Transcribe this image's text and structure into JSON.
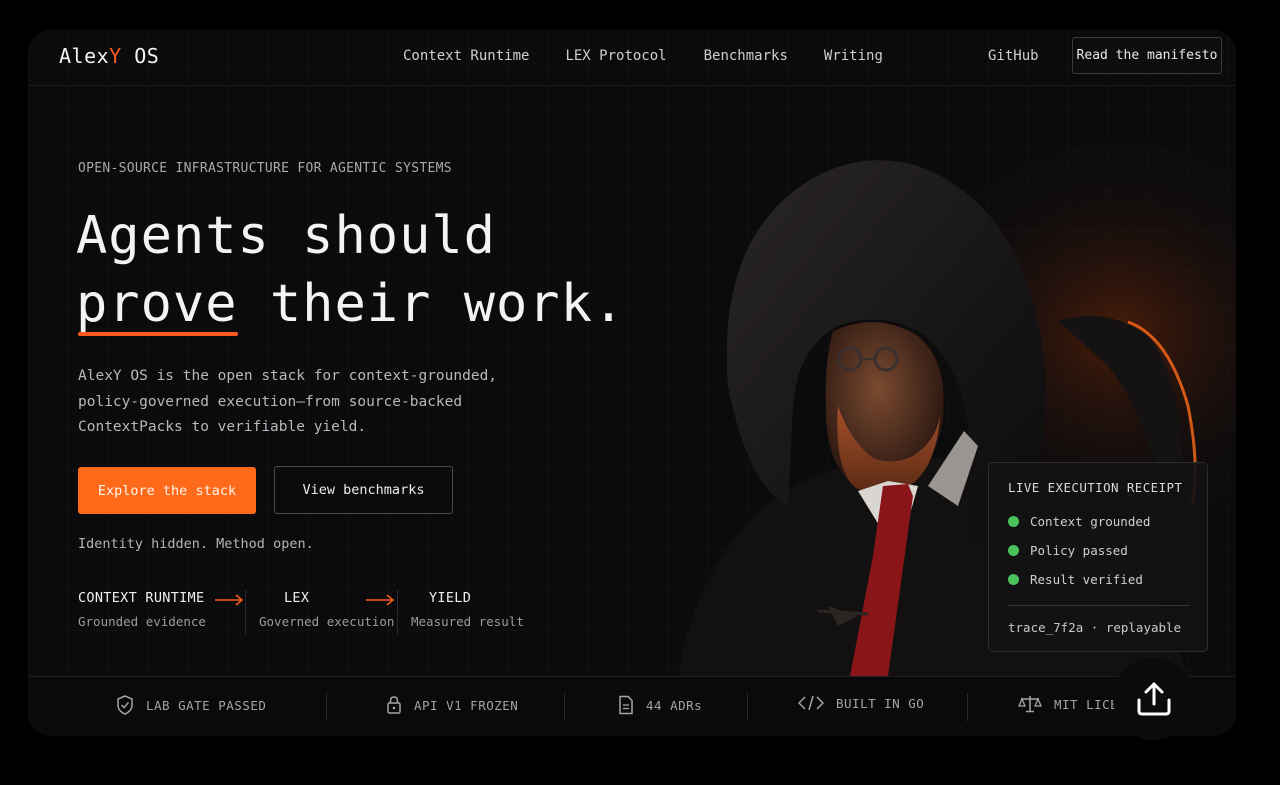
{
  "nav": {
    "brand_prefix": "Alex",
    "brand_accent": "Y",
    "brand_suffix": " OS",
    "links": [
      "Context Runtime",
      "LEX Protocol",
      "Benchmarks",
      "Writing"
    ],
    "github": "GitHub",
    "cta": "Read the manifesto"
  },
  "hero": {
    "eyebrow": "OPEN-SOURCE INFRASTRUCTURE FOR AGENTIC SYSTEMS",
    "headline_line1": "Agents should",
    "headline_highlight": "prove",
    "headline_rest": " their work.",
    "description": "AlexY OS is the open stack for context-grounded, policy-governed execution—from source-backed ContextPacks to verifiable yield.",
    "primary_button": "Explore the stack",
    "secondary_button": "View benchmarks",
    "tagline": "Identity hidden. Method open."
  },
  "pipeline": [
    {
      "title": "CONTEXT RUNTIME",
      "subtitle": "Grounded evidence"
    },
    {
      "title": "LEX",
      "subtitle": "Governed execution"
    },
    {
      "title": "YIELD",
      "subtitle": "Measured result"
    }
  ],
  "receipt": {
    "title": "LIVE EXECUTION RECEIPT",
    "items": [
      "Context grounded",
      "Policy passed",
      "Result verified"
    ],
    "trace": "trace_7f2a · replayable"
  },
  "badges": [
    {
      "icon": "shield-check-icon",
      "label": "LAB GATE PASSED"
    },
    {
      "icon": "lock-icon",
      "label": "API V1 FROZEN"
    },
    {
      "icon": "document-icon",
      "label": "44 ADRs"
    },
    {
      "icon": "code-icon",
      "label": "BUILT IN GO"
    },
    {
      "icon": "scale-icon",
      "label": "MIT LICE"
    }
  ],
  "colors": {
    "accent": "#ff5a1f",
    "button": "#ff6a1a",
    "status_green": "#4cc35a",
    "background": "#0b0b0d"
  }
}
